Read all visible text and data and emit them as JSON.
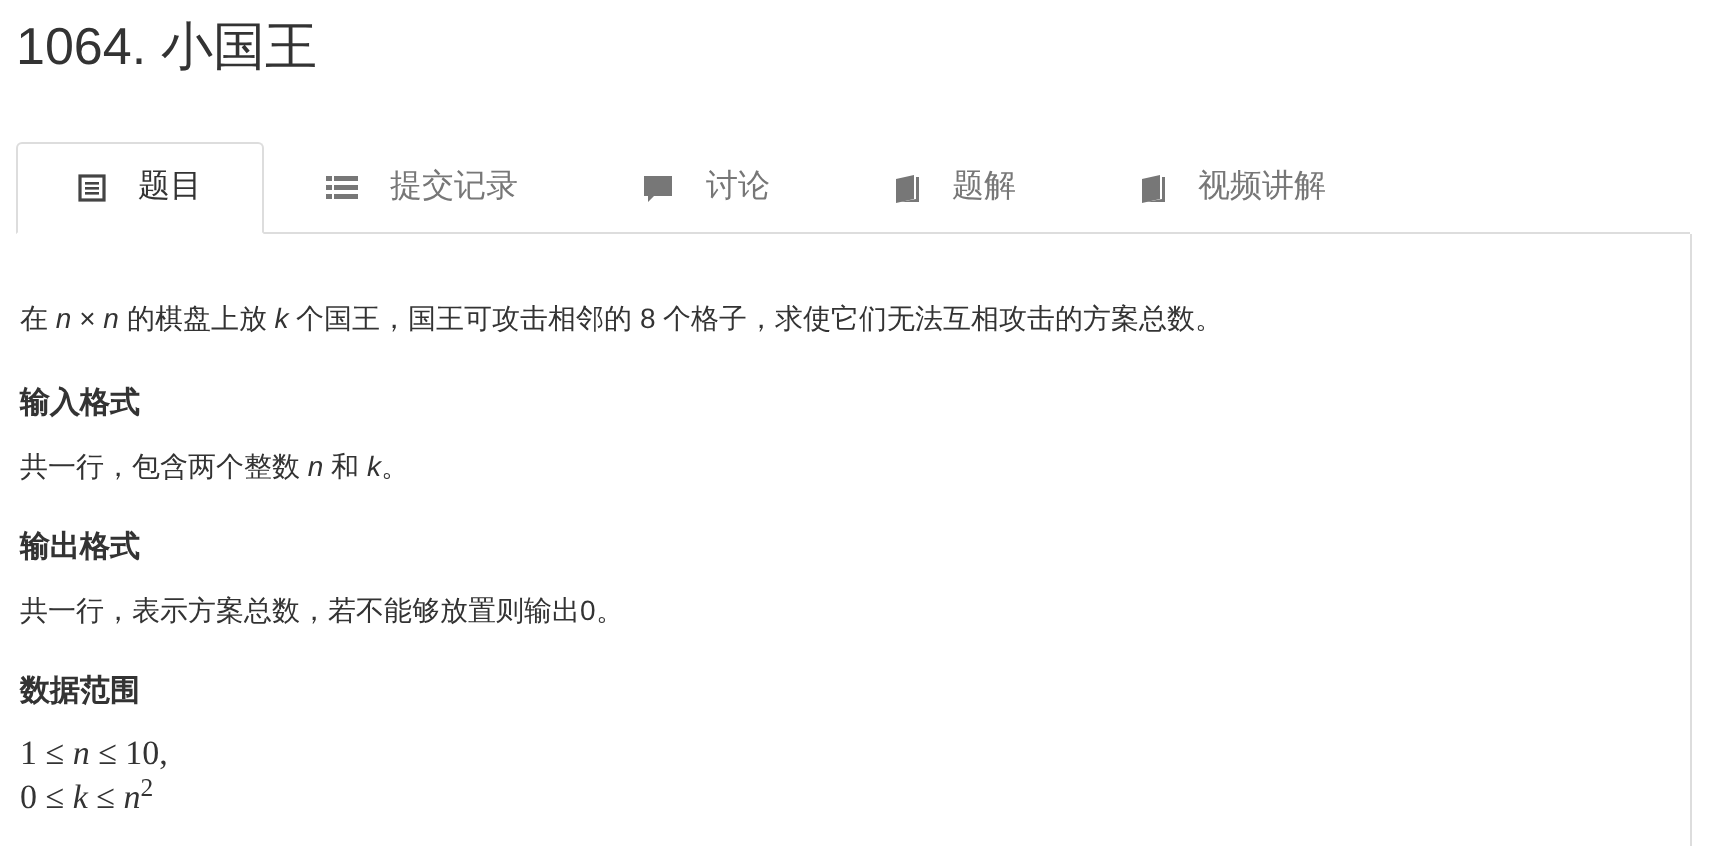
{
  "title": "1064. 小国王",
  "tabs": [
    {
      "label": "题目",
      "selected": true
    },
    {
      "label": "提交记录",
      "selected": false
    },
    {
      "label": "讨论",
      "selected": false
    },
    {
      "label": "题解",
      "selected": false
    },
    {
      "label": "视频讲解",
      "selected": false
    }
  ],
  "description": "在 *n* × *n* 的棋盘上放 *k* 个国王，国王可攻击相邻的 8 个格子，求使它们无法互相攻击的方案总数。",
  "sections": [
    {
      "heading": "输入格式",
      "lines": [
        "共一行，包含两个整数 *n* 和 *k*。"
      ]
    },
    {
      "heading": "输出格式",
      "lines": [
        "共一行，表示方案总数，若不能够放置则输出0。"
      ]
    },
    {
      "heading": "数据范围",
      "lines": [
        "1 ≤ *n* ≤ 10,",
        "0 ≤ *k* ≤ *n*$^{2}$"
      ]
    }
  ]
}
